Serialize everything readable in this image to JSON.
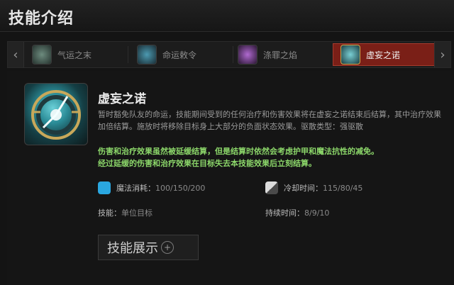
{
  "header": {
    "title": "技能介绍"
  },
  "tabs": [
    {
      "label": "气运之末",
      "icon": "skill-fate-end-icon"
    },
    {
      "label": "命运敕令",
      "icon": "skill-fate-edict-icon"
    },
    {
      "label": "涤罪之焰",
      "icon": "skill-purifying-flames-icon"
    },
    {
      "label": "虚妄之诺",
      "icon": "skill-false-promise-icon"
    }
  ],
  "active_tab": 3,
  "skill": {
    "name": "虚妄之诺",
    "description": "暂时豁免队友的命运，技能期间受到的任何治疗和伤害效果将在虚妄之诺结束后结算，其中治疗效果加倍结算。施放时将移除目标身上大部分的负面状态效果。驱散类型：强驱散",
    "note_line1": "伤害和治疗效果虽然被延缓结算，但是结算时依然会考虑护甲和魔法抗性的减免。",
    "note_line2": "经过延缓的伤害和治疗效果在目标失去本技能效果后立刻结算。",
    "mana_label": "魔法消耗：",
    "mana_value": "100/150/200",
    "cooldown_label": "冷却时间：",
    "cooldown_value": "115/80/45",
    "ability_label": "技能：",
    "ability_value": "单位目标",
    "duration_label": "持续时间：",
    "duration_value": "8/9/10",
    "showcase_button": "技能展示"
  },
  "colors": {
    "accent_tab": "#7a1f17",
    "highlight_green": "#8cd76a",
    "mana_blue": "#2aa7e0"
  }
}
